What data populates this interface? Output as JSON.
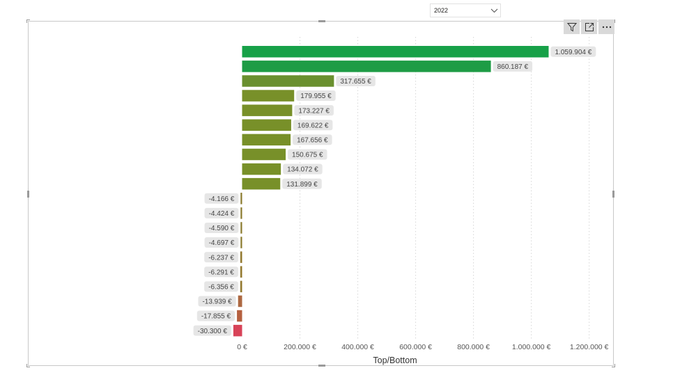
{
  "slicer": {
    "selected": "2022"
  },
  "visual_header": {
    "icons": [
      "filter-icon",
      "focus-mode-icon",
      "more-options-icon"
    ]
  },
  "chart_data": {
    "type": "bar",
    "orientation": "horizontal",
    "xlabel": "Top/Bottom",
    "xlim": [
      -50000,
      1250000
    ],
    "xticks": [
      0,
      200000,
      400000,
      600000,
      800000,
      1000000,
      1200000
    ],
    "xtick_labels": [
      "0 €",
      "200.000 €",
      "400.000 €",
      "600.000 €",
      "800.000 €",
      "1.000.000 €",
      "1.200.000 €"
    ],
    "grid": "vertical-dotted",
    "values": [
      1059904,
      860187,
      317655,
      179955,
      173227,
      169622,
      167656,
      150675,
      134072,
      131899,
      -4166,
      -4424,
      -4590,
      -4697,
      -6237,
      -6291,
      -6356,
      -13939,
      -17855,
      -30300
    ],
    "data_labels": [
      "1.059.904 €",
      "860.187 €",
      "317.655 €",
      "179.955 €",
      "173.227 €",
      "169.622 €",
      "167.656 €",
      "150.675 €",
      "134.072 €",
      "131.899 €",
      "-4.166 €",
      "-4.424 €",
      "-4.590 €",
      "-4.697 €",
      "-6.237 €",
      "-6.291 €",
      "-6.356 €",
      "-13.939 €",
      "-17.855 €",
      "-30.300 €"
    ],
    "colors": [
      "#17a148",
      "#1e9c45",
      "#6a902f",
      "#789029",
      "#789029",
      "#789029",
      "#789029",
      "#789029",
      "#789029",
      "#789029",
      "#8a7a2c",
      "#8a7a2c",
      "#8a7a2c",
      "#8a7a2c",
      "#93792f",
      "#93792f",
      "#93792f",
      "#ad6841",
      "#b5603f",
      "#d84358"
    ]
  }
}
